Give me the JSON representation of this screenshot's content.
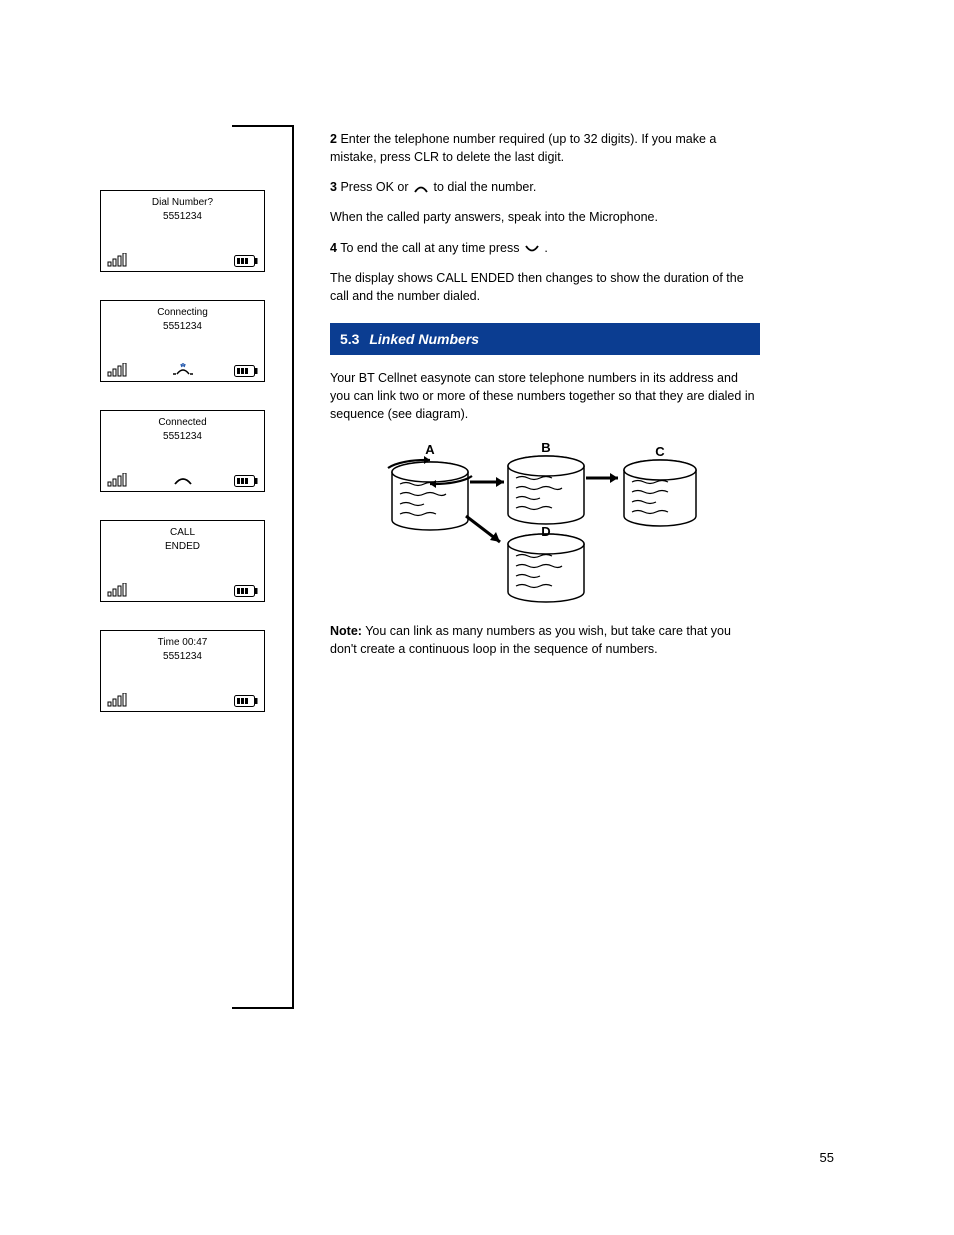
{
  "page_number": "55",
  "screens": [
    {
      "line1": "Dial Number?",
      "line2": "5551234",
      "icon": "none"
    },
    {
      "line1": "Connecting",
      "line2": "5551234",
      "icon": "hook-flash"
    },
    {
      "line1": "Connected",
      "line2": "5551234",
      "icon": "hook"
    },
    {
      "line1": "CALL",
      "line2": "ENDED",
      "icon": "none"
    },
    {
      "line1": "Time 00:47",
      "line2": "5551234",
      "icon": "none"
    }
  ],
  "steps": [
    {
      "n": "2",
      "text": "Enter the telephone number required (up to 32 digits). If you make a mistake, press CLR to delete the last digit."
    },
    {
      "n": "3",
      "text_a": "Press OK or ",
      "text_b": " to dial the number."
    },
    {
      "n": "",
      "text": "When the called party answers, speak into the Microphone."
    },
    {
      "n": "4",
      "text_a": "To end the call at any time press ",
      "text_b": "."
    },
    {
      "n": "",
      "text": "The display shows CALL ENDED then changes to show the duration of the call and the number dialed."
    }
  ],
  "section": {
    "num": "5.3",
    "title": "Linked Numbers"
  },
  "body": {
    "p1": "Your BT Cellnet easynote can store telephone numbers in its address and you can link two or more of these numbers together so that they are dialed in sequence (see diagram).",
    "diagram_labels": {
      "a": "A",
      "b": "B",
      "c": "C",
      "d": "D"
    },
    "p2_label": "Note:",
    "p2": "You can link as many numbers as you wish, but take care that you don't create a continuous loop in the sequence of numbers."
  }
}
